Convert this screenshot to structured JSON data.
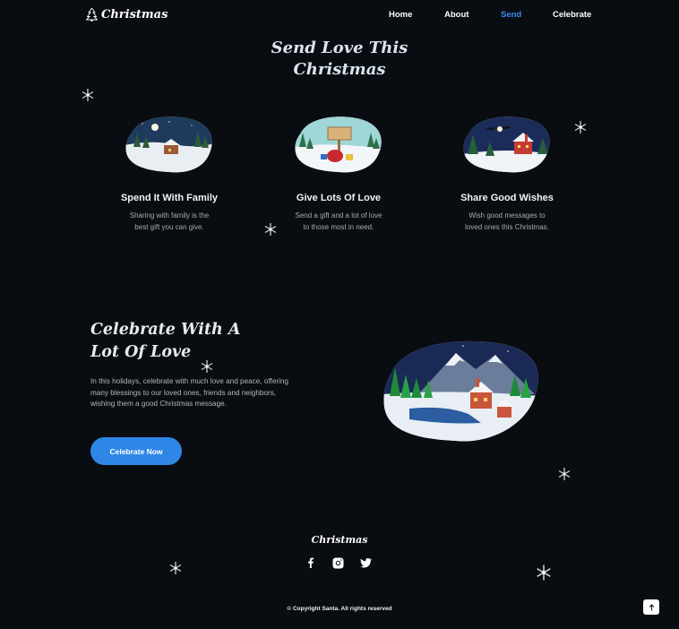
{
  "header": {
    "logo_text": "Christmas",
    "logo_icon": "christmas-tree-icon",
    "nav": [
      {
        "label": "Home",
        "active": false
      },
      {
        "label": "About",
        "active": false
      },
      {
        "label": "Send",
        "active": true
      },
      {
        "label": "Celebrate",
        "active": false
      }
    ]
  },
  "send": {
    "title_line1": "Send Love This",
    "title_line2": "Christmas",
    "cards": [
      {
        "title": "Spend It With Family",
        "text": "Sharing with family is the best gift you can give.",
        "image": "snowy-night-village-image"
      },
      {
        "title": "Give Lots Of Love",
        "text": "Send a gift and a lot of love to those most in need.",
        "image": "gift-sack-sign-image"
      },
      {
        "title": "Share Good Wishes",
        "text": "Wish good messages to loved ones this Christmas.",
        "image": "santa-sleigh-village-image"
      }
    ]
  },
  "celebrate": {
    "title_line1": "Celebrate With A",
    "title_line2": "Lot Of Love",
    "text": "In this holidays, celebrate with much love and peace, offering many blessings to our loved ones, friends and neighbors, wishing them a good Christmas message.",
    "button_label": "Celebrate Now",
    "image": "winter-mountain-village-image"
  },
  "footer": {
    "logo_text": "Christmas",
    "socials": [
      "facebook-icon",
      "instagram-icon",
      "twitter-icon"
    ],
    "copyright": "© Copyright Santa. All rights reserved"
  },
  "colors": {
    "background": "#090c10",
    "accent": "#2f86e6",
    "active_nav": "#3a8bf0"
  }
}
